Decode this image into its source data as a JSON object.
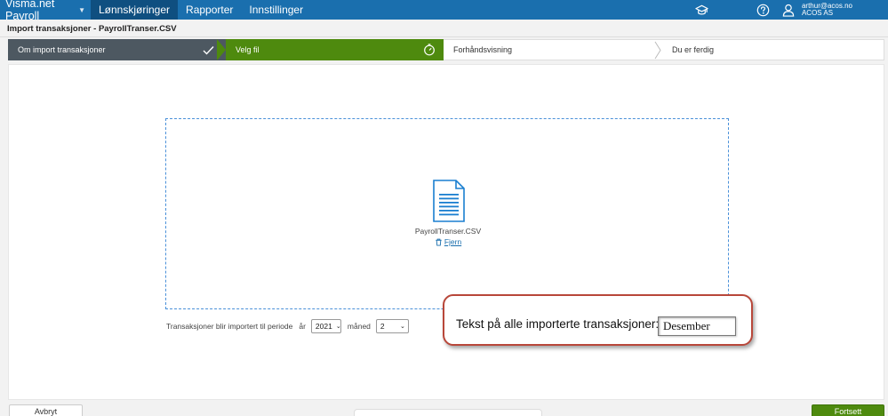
{
  "topbar": {
    "brand": "Visma.net Payroll",
    "nav": [
      {
        "label": "Lønnskjøringer",
        "active": true
      },
      {
        "label": "Rapporter",
        "active": false
      },
      {
        "label": "Innstillinger",
        "active": false
      }
    ],
    "user_email": "arthur@acos.no",
    "user_company": "ACOS AS",
    "icons": [
      "graduation-cap-icon",
      "help-icon",
      "user-icon"
    ]
  },
  "page": {
    "title": "Import transaksjoner - PayrollTranser.CSV"
  },
  "wizard": {
    "steps": [
      {
        "label": "Om import transaksjoner",
        "state": "done"
      },
      {
        "label": "Velg fil",
        "state": "active"
      },
      {
        "label": "Forhåndsvisning",
        "state": "pending"
      },
      {
        "label": "Du er ferdig",
        "state": "pending"
      }
    ]
  },
  "dropzone": {
    "file_name": "PayrollTranser.CSV",
    "remove_label": "Fjern"
  },
  "period": {
    "label": "Transaksjoner blir importert til periode",
    "year_label": "år",
    "year_value": "2021",
    "month_label": "måned",
    "month_value": "2"
  },
  "callout": {
    "label": "Tekst på alle importerte transaksjoner:",
    "value": "Desember"
  },
  "footer": {
    "cancel_label": "Avbryt",
    "continue_label": "Fortsett"
  },
  "colors": {
    "topbar": "#1a6fae",
    "nav_active": "#0f4f80",
    "step_done": "#4d5861",
    "step_active": "#4e8a0e",
    "dropzone_border": "#4a90d9",
    "callout_border": "#b8473a"
  }
}
